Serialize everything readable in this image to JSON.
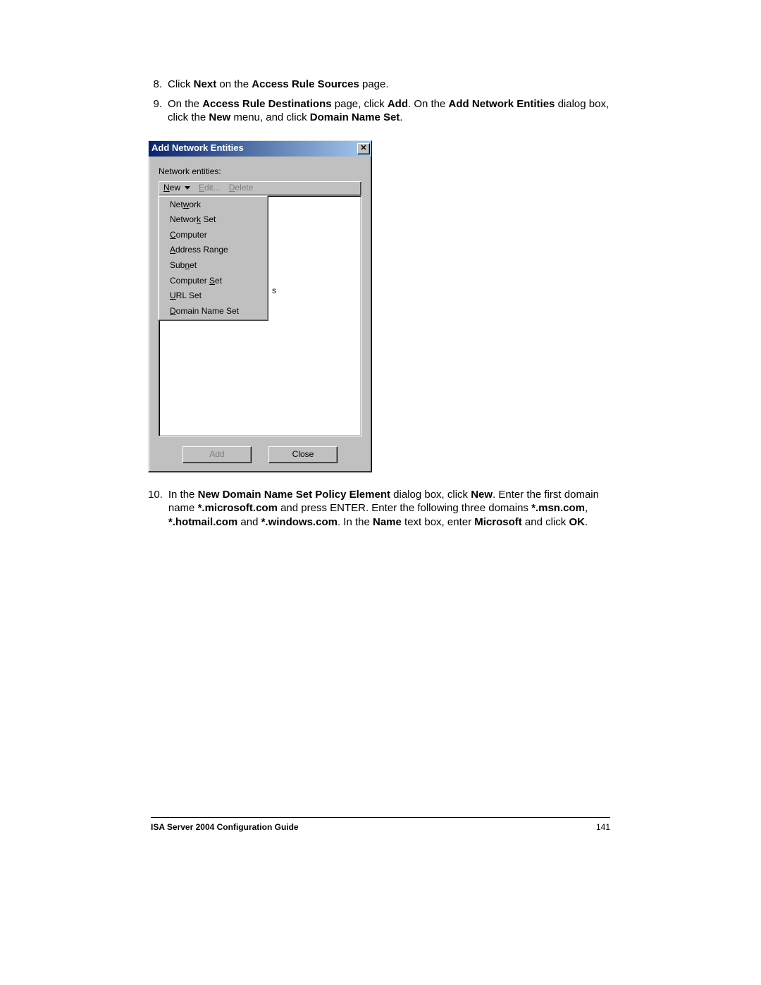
{
  "steps": [
    {
      "num": "8.",
      "parts": [
        {
          "t": "Click "
        },
        {
          "t": "Next",
          "b": true
        },
        {
          "t": " on the "
        },
        {
          "t": "Access Rule Sources",
          "b": true
        },
        {
          "t": " page."
        }
      ]
    },
    {
      "num": "9.",
      "parts": [
        {
          "t": "On the "
        },
        {
          "t": "Access Rule Destinations",
          "b": true
        },
        {
          "t": " page, click "
        },
        {
          "t": "Add",
          "b": true
        },
        {
          "t": ". On the "
        },
        {
          "t": "Add Network Entities",
          "b": true
        },
        {
          "t": " dialog box, click the "
        },
        {
          "t": "New",
          "b": true
        },
        {
          "t": " menu, and click "
        },
        {
          "t": "Domain Name Set",
          "b": true
        },
        {
          "t": "."
        }
      ]
    },
    {
      "num": "10.",
      "parts": [
        {
          "t": "In the "
        },
        {
          "t": "New Domain Name Set Policy Element",
          "b": true
        },
        {
          "t": " dialog box, click "
        },
        {
          "t": "New",
          "b": true
        },
        {
          "t": ". Enter the first domain name "
        },
        {
          "t": "*.microsoft.com",
          "b": true
        },
        {
          "t": " and press ENTER. Enter the following three domains "
        },
        {
          "t": "*.msn.com",
          "b": true
        },
        {
          "t": ", "
        },
        {
          "t": "*.hotmail.com",
          "b": true
        },
        {
          "t": " and "
        },
        {
          "t": "*.windows.com",
          "b": true
        },
        {
          "t": ". In the "
        },
        {
          "t": "Name",
          "b": true
        },
        {
          "t": " text box, enter "
        },
        {
          "t": "Microsoft",
          "b": true
        },
        {
          "t": " and click "
        },
        {
          "t": "OK",
          "b": true
        },
        {
          "t": "."
        }
      ]
    }
  ],
  "dialog": {
    "title": "Add Network Entities",
    "close_glyph": "✕",
    "list_label": "Network entities:",
    "toolbar": {
      "new": {
        "pre": "N",
        "post": "ew"
      },
      "edit": {
        "pre": "E",
        "post": "dit..."
      },
      "delete": {
        "pre": "D",
        "post": "elete"
      }
    },
    "menu_items": [
      {
        "pre": "Net",
        "u": "w",
        "post": "ork"
      },
      {
        "pre": "Networ",
        "u": "k",
        "post": " Set"
      },
      {
        "pre": "",
        "u": "C",
        "post": "omputer"
      },
      {
        "pre": "",
        "u": "A",
        "post": "ddress Range"
      },
      {
        "pre": "Sub",
        "u": "n",
        "post": "et"
      },
      {
        "pre": "Computer ",
        "u": "S",
        "post": "et"
      },
      {
        "pre": "",
        "u": "U",
        "post": "RL Set"
      },
      {
        "pre": "",
        "u": "D",
        "post": "omain Name Set"
      }
    ],
    "peek_char": "s",
    "buttons": {
      "add": "Add",
      "close": "Close"
    }
  },
  "footer": {
    "title": "ISA Server 2004 Configuration Guide",
    "page": "141"
  }
}
